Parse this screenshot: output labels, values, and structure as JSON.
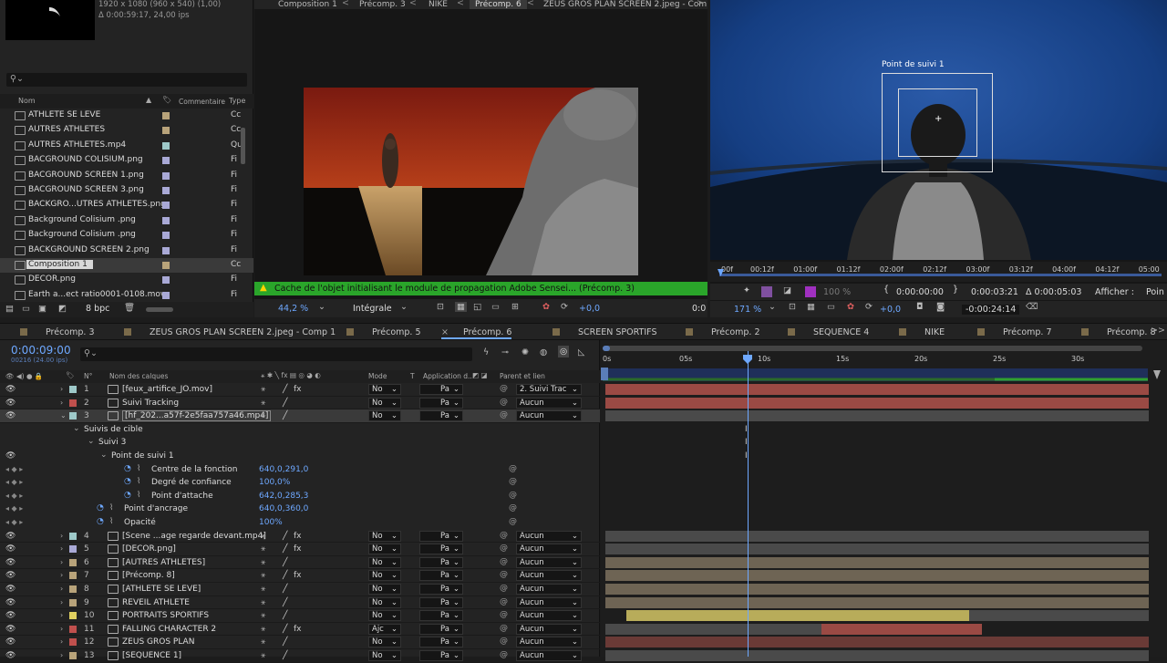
{
  "project": {
    "meta_line1": "1920 x 1080  (960 x 540) (1,00)",
    "meta_line2": "Δ 0:00:59:17, 24,00 ips",
    "search_placeholder": "",
    "col_name": "Nom",
    "col_comment": "Commentaire",
    "col_type": "Type",
    "items": [
      {
        "name": "ATHLETE SE LEVE",
        "color": "#b8a37a",
        "type": "Cc"
      },
      {
        "name": "AUTRES ATHLETES",
        "color": "#b8a37a",
        "type": "Cc"
      },
      {
        "name": "AUTRES ATHLETES.mp4",
        "color": "#9ec9c9",
        "type": "Qu"
      },
      {
        "name": "BACGROUND COLISIUM.png",
        "color": "#a9a9d6",
        "type": "Fi"
      },
      {
        "name": "BACGROUND SCREEN 1.png",
        "color": "#a9a9d6",
        "type": "Fi"
      },
      {
        "name": "BACGROUND SCREEN 3.png",
        "color": "#a9a9d6",
        "type": "Fi"
      },
      {
        "name": "BACKGRO...UTRES ATHLETES.png",
        "color": "#a9a9d6",
        "type": "Fi"
      },
      {
        "name": "Background Colisium .png",
        "color": "#a9a9d6",
        "type": "Fi"
      },
      {
        "name": "Background Colisium .png",
        "color": "#a9a9d6",
        "type": "Fi"
      },
      {
        "name": "BACKGROUND SCREEN 2.png",
        "color": "#a9a9d6",
        "type": "Fi"
      },
      {
        "name": "Composition 1",
        "color": "#b8a37a",
        "type": "Cc"
      },
      {
        "name": "DECOR.png",
        "color": "#a9a9d6",
        "type": "Fi"
      },
      {
        "name": "Earth a...ect ratio0001-0108.mov",
        "color": "#a9a9d6",
        "type": "Fi"
      }
    ],
    "bpc": "8 bpc"
  },
  "viewer": {
    "tabs": [
      "Composition 1",
      "Précomp. 3",
      "NIKE",
      "Précomp. 6",
      "ZEUS GROS PLAN SCREEN 2.jpeg - Com"
    ],
    "active_tab": "Précomp. 6",
    "status": "Cache de l'objet initialisant le module de propagation Adobe Sensei... (Précomp. 3)",
    "zoom": "44,2 %",
    "resolution": "Intégrale",
    "exposure": "+0,0",
    "timecode": "0:0"
  },
  "layer_viewer": {
    "track_label": "Point de suivi 1",
    "ruler": [
      "00f",
      "00:12f",
      "01:00f",
      "01:12f",
      "02:00f",
      "02:12f",
      "03:00f",
      "03:12f",
      "04:00f",
      "04:12f",
      "05:00"
    ],
    "zoom": "171 %",
    "pct": "100 %",
    "in_time": "0:00:00:00",
    "out_time": "0:00:03:21",
    "duration": "Δ 0:00:05:03",
    "afficher_label": "Afficher :",
    "afficher_value": "Poin",
    "exposure": "+0,0",
    "offset_time": "-0:00:24:14"
  },
  "timeline": {
    "tabs": [
      "Précomp. 3",
      "ZEUS GROS PLAN SCREEN 2.jpeg - Comp 1",
      "Précomp. 5",
      "Précomp. 6",
      "SCREEN SPORTIFS",
      "Précomp. 2",
      "SEQUENCE 4",
      "NIKE",
      "Précomp. 7",
      "Précomp. 8"
    ],
    "active_tab": "Précomp. 6",
    "current_time": "0:00:09:00",
    "frames": "00216 (24.00 ips)",
    "headers": {
      "name": "Nom des calques",
      "mode": "Mode",
      "t": "T",
      "trkmat": "Application d...",
      "parent": "Parent et lien"
    },
    "ruler": [
      "0s",
      "05s",
      "10s",
      "15s",
      "20s",
      "25s",
      "30s"
    ],
    "layers": [
      {
        "num": "1",
        "name": "[feux_artifice_JO.mov]",
        "color": "#9ec9c9",
        "mode": "No",
        "trk": "Pa",
        "parent": "2. Suivi Trac",
        "fx": true
      },
      {
        "num": "2",
        "name": "Suivi Tracking",
        "color": "#c0504d",
        "mode": "No",
        "trk": "Pa",
        "parent": "Aucun",
        "fx": false
      },
      {
        "num": "3",
        "name": "[hf_202...a57f-2e5faa757a46.mp4]",
        "color": "#9ec9c9",
        "mode": "No",
        "trk": "Pa",
        "parent": "Aucun",
        "fx": false
      }
    ],
    "tracker": {
      "g1": "Suivis de cible",
      "g2": "Suivi 3",
      "g3": "Point de suivi 1",
      "props": [
        {
          "name": "Centre de la fonction",
          "value": "640,0,291,0"
        },
        {
          "name": "Degré de confiance",
          "value": "100,0%"
        },
        {
          "name": "Point d'attache",
          "value": "642,0,285,3"
        }
      ],
      "anchor_name": "Point d'ancrage",
      "anchor_value": "640,0,360,0",
      "opacity_name": "Opacité",
      "opacity_value": "100%"
    },
    "layers2": [
      {
        "num": "4",
        "name": "[Scene ...age regarde devant.mp4]",
        "color": "#9ec9c9",
        "mode": "No",
        "trk": "Pa",
        "parent": "Aucun",
        "fx": true
      },
      {
        "num": "5",
        "name": "[DECOR.png]",
        "color": "#a9a9d6",
        "mode": "No",
        "trk": "Pa",
        "parent": "Aucun",
        "fx": true
      },
      {
        "num": "6",
        "name": "[AUTRES ATHLETES]",
        "color": "#b8a37a",
        "mode": "No",
        "trk": "Pa",
        "parent": "Aucun",
        "fx": false
      },
      {
        "num": "7",
        "name": "[Précomp. 8]",
        "color": "#b8a37a",
        "mode": "No",
        "trk": "Pa",
        "parent": "Aucun",
        "fx": true
      },
      {
        "num": "8",
        "name": "[ATHLETE SE LEVE]",
        "color": "#b8a37a",
        "mode": "No",
        "trk": "Pa",
        "parent": "Aucun",
        "fx": false
      },
      {
        "num": "9",
        "name": "REVEIL ATHLETE",
        "color": "#b8a37a",
        "mode": "No",
        "trk": "Pa",
        "parent": "Aucun",
        "fx": false
      },
      {
        "num": "10",
        "name": "PORTRAITS SPORTIFS",
        "color": "#e0d060",
        "mode": "No",
        "trk": "Pa",
        "parent": "Aucun",
        "fx": false
      },
      {
        "num": "11",
        "name": "FALLING CHARACTER 2",
        "color": "#c0504d",
        "mode": "Ajc",
        "trk": "Pa",
        "parent": "Aucun",
        "fx": true
      },
      {
        "num": "12",
        "name": "ZEUS GROS PLAN",
        "color": "#c0504d",
        "mode": "No",
        "trk": "Pa",
        "parent": "Aucun",
        "fx": false
      },
      {
        "num": "13",
        "name": "[SEQUENCE 1]",
        "color": "#b8a37a",
        "mode": "No",
        "trk": "Pa",
        "parent": "Aucun",
        "fx": false
      }
    ]
  }
}
